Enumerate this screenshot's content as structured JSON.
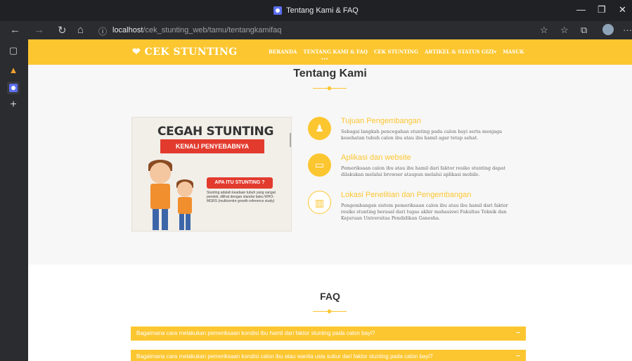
{
  "browser": {
    "tab_title": "Tentang Kami & FAQ",
    "url_host": "localhost",
    "url_path": "/cek_stunting_web/tamu/tentangkamifaq",
    "minimize": "—",
    "maximize": "❐",
    "close": "✕",
    "more": "···"
  },
  "site": {
    "logo": "CEK STUNTING",
    "menu": [
      "BERANDA",
      "TENTANG KAMI & FAQ",
      "CEK STUNTING",
      "ARTIKEL & STATUS GIZI▾",
      "MASUK"
    ],
    "menu_dots": "•••"
  },
  "about": {
    "title": "Tentang Kami",
    "poster": {
      "title": "CEGAH STUNTING",
      "subtitle": "KENALI PENYEBABNYA",
      "badge": "APA ITU STUNTING ?",
      "text": "Stunting adalah keadaan tubuh yang sangat pendek, dilihat dengan standar baku WHO-MGRS (multicentre growth reference study)"
    },
    "features": [
      {
        "icon": "person-icon",
        "title": "Tujuan Pengembangan",
        "desc": "Sebagai langkah pencegahan stunting pada calon bayi serta menjaga kesehatan tubuh calon ibu atau ibu hamil agar tetap sehat."
      },
      {
        "icon": "laptop-icon",
        "title": "Aplikasi dan website",
        "desc": "Pemeriksaan calon ibu atau ibu hamil dari faktor resiko stunting dapat dilakukan melalui browser ataupun melalui aplikasi mobile."
      },
      {
        "icon": "building-icon",
        "title": "Lokasi Penelitian dan Pengembangan",
        "desc": "Pengembangan sistem pemeriksaan calon ibu atau ibu hamil dari faktor resiko stunting berasal dari tugas akhir mahasiswi Fakultas Teknik dan Kejuruan Universitas Pendidikan Ganesha."
      }
    ]
  },
  "faq": {
    "title": "FAQ",
    "items": [
      {
        "q": "Bagaimana cara melakukan pemeriksaan kondisi ibu hamil dari faktor stunting pada calon bayi?",
        "toggle": "−"
      },
      {
        "q": "Bagaimana cara melakukan pemeriksaan kondisi calon ibu atau wanita usia subur dari faktor stunting pada calon bayi?",
        "toggle": "−"
      }
    ]
  },
  "colors": {
    "accent": "#fcc630",
    "poster_red": "#e23b2e"
  }
}
